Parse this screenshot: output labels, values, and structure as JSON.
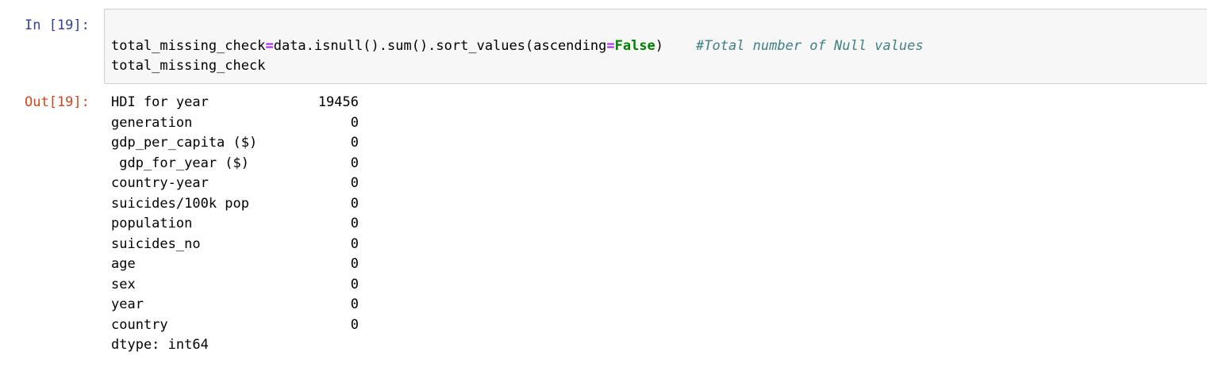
{
  "cell": {
    "in_prompt": "In [19]:",
    "out_prompt": "Out[19]:",
    "code": {
      "line1_var": "total_missing_check",
      "line1_eq": "=",
      "line1_expr": "data.isnull().sum().sort_values(ascending",
      "line1_eq2": "=",
      "line1_kw": "False",
      "line1_close": ")",
      "line1_comment": "#Total number of Null values",
      "line2": "total_missing_check"
    },
    "output": {
      "rows": [
        {
          "label": "HDI for year",
          "value": "19456"
        },
        {
          "label": "generation",
          "value": "0"
        },
        {
          "label": "gdp_per_capita ($)",
          "value": "0"
        },
        {
          "label": " gdp_for_year ($)",
          "value": "0"
        },
        {
          "label": "country-year",
          "value": "0"
        },
        {
          "label": "suicides/100k pop",
          "value": "0"
        },
        {
          "label": "population",
          "value": "0"
        },
        {
          "label": "suicides_no",
          "value": "0"
        },
        {
          "label": "age",
          "value": "0"
        },
        {
          "label": "sex",
          "value": "0"
        },
        {
          "label": "year",
          "value": "0"
        },
        {
          "label": "country",
          "value": "0"
        }
      ],
      "dtype": "dtype: int64"
    }
  },
  "colors": {
    "in_prompt": "#303f9f",
    "out_prompt": "#d84315",
    "operator": "#aa22ff",
    "keyword": "#008000",
    "comment": "#408080",
    "input_bg": "#f7f7f7"
  }
}
